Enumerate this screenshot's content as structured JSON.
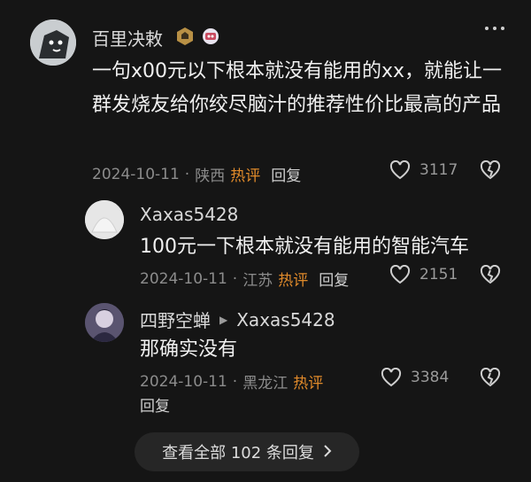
{
  "comments": [
    {
      "user": "百里决敕",
      "text": "一句x00元以下根本就没有能用的xx，就能让一群发烧友给你绞尽脑汁的推荐性价比最高的产品",
      "date": "2024-10-11",
      "location": "陕西",
      "hot": "热评",
      "reply": "回复",
      "likes": "3117"
    },
    {
      "user": "Xaxas5428",
      "text": "100元一下根本就没有能用的智能汽车",
      "date": "2024-10-11",
      "location": "江苏",
      "hot": "热评",
      "reply": "回复",
      "likes": "2151"
    },
    {
      "user": "四野空蝉",
      "reply_to": "Xaxas5428",
      "text": "那确实没有",
      "date": "2024-10-11",
      "location": "黑龙江",
      "hot": "热评",
      "reply": "回复",
      "likes": "3384"
    }
  ],
  "view_all": "查看全部 102 条回复",
  "colors": {
    "background": "#151515",
    "hot": "#e08a2a"
  }
}
